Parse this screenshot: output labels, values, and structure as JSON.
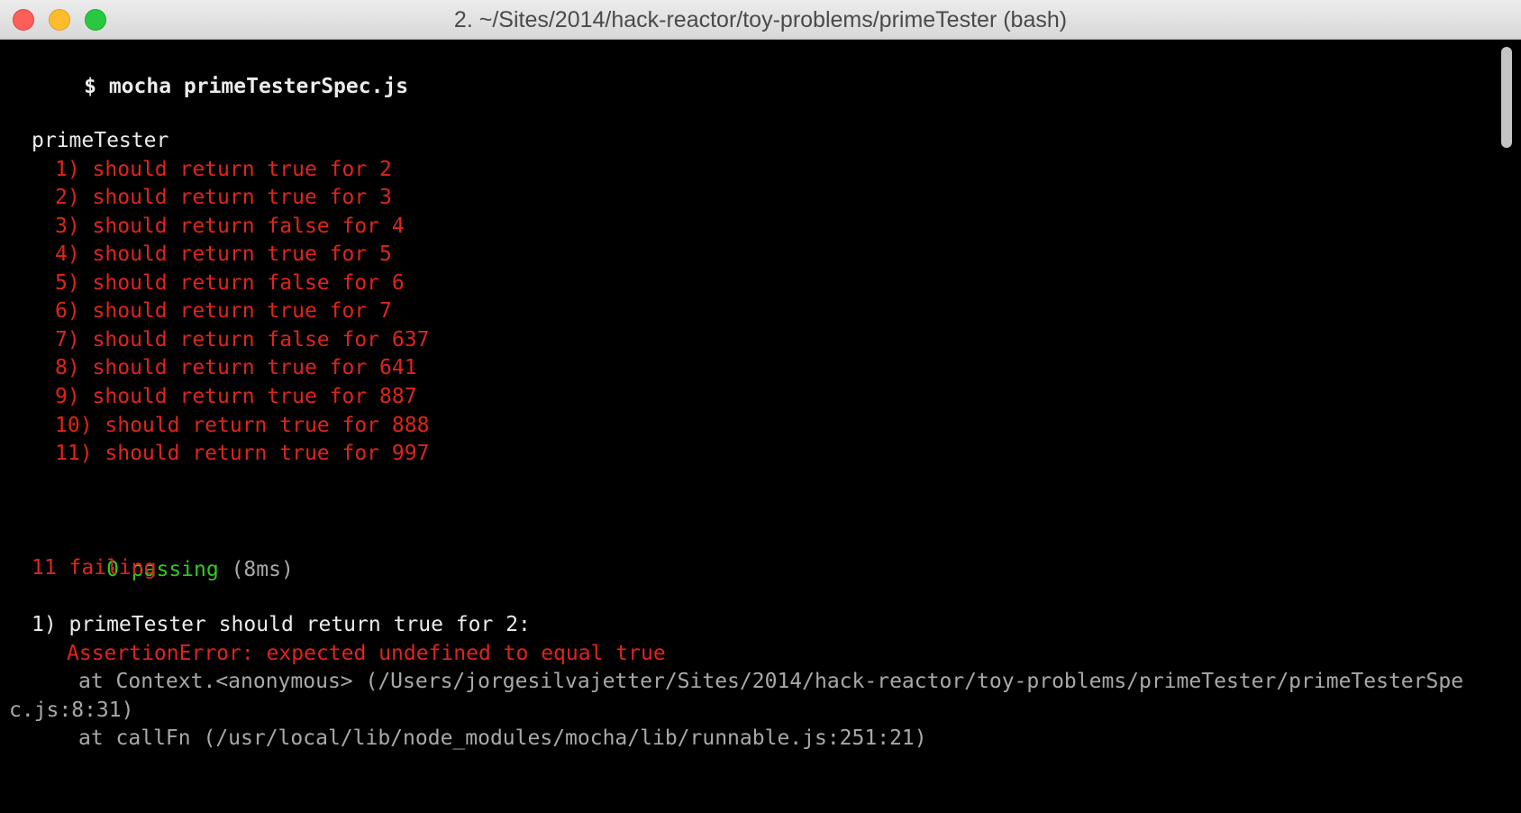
{
  "window": {
    "title": "2. ~/Sites/2014/hack-reactor/toy-problems/primeTester (bash)"
  },
  "terminal": {
    "prompt": "$",
    "command": "mocha primeTesterSpec.js",
    "suite_name": "primeTester",
    "failing_tests": [
      "1) should return true for 2",
      "2) should return true for 3",
      "3) should return false for 4",
      "4) should return true for 5",
      "5) should return false for 6",
      "6) should return true for 7",
      "7) should return false for 637",
      "8) should return true for 641",
      "9) should return true for 887",
      "10) should return true for 888",
      "11) should return true for 997"
    ],
    "passing_summary": "0 passing",
    "passing_time": "(8ms)",
    "failing_summary": "11 failing",
    "failure_detail": {
      "title": "1) primeTester should return true for 2:",
      "error": "AssertionError: expected undefined to equal true",
      "stack_line_1": "at Context.<anonymous> (/Users/jorgesilvajetter/Sites/2014/hack-reactor/toy-problems/primeTester/primeTesterSpe",
      "stack_line_1_wrap": "c.js:8:31)",
      "stack_line_2": "at callFn (/usr/local/lib/node_modules/mocha/lib/runnable.js:251:21)"
    }
  },
  "colors": {
    "background": "#000000",
    "fail": "#e0241c",
    "pass": "#2ecc1f",
    "text": "#ececec"
  }
}
